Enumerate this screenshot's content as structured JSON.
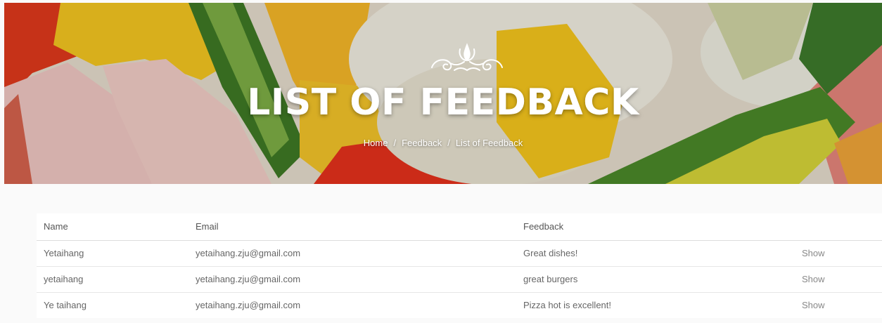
{
  "hero": {
    "title": "LIST OF FEEDBACK",
    "breadcrumb": {
      "home": "Home",
      "separator": "/",
      "section": "Feedback",
      "current": "List of Feedback"
    }
  },
  "table": {
    "headers": {
      "name": "Name",
      "email": "Email",
      "feedback": "Feedback",
      "action": ""
    },
    "rows": [
      {
        "name": "Yetaihang",
        "email": "yetaihang.zju@gmail.com",
        "feedback": "Great dishes!",
        "action": "Show"
      },
      {
        "name": "yetaihang",
        "email": "yetaihang.zju@gmail.com",
        "feedback": "great burgers",
        "action": "Show"
      },
      {
        "name": "Ye taihang",
        "email": "yetaihang.zju@gmail.com",
        "feedback": "Pizza hot is excellent!",
        "action": "Show"
      }
    ]
  }
}
